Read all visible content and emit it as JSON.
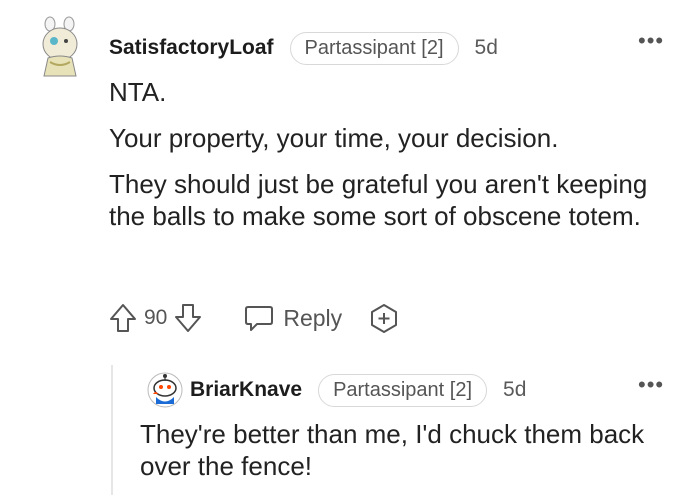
{
  "comment": {
    "author": "SatisfactoryLoaf",
    "flair": "Partassipant [2]",
    "time": "5d",
    "more_label": "•••",
    "paragraphs": [
      "NTA.",
      "Your property, your time, your decision.",
      "They should just be grateful you aren't keeping the balls to make some sort of obscene totem."
    ],
    "votes": "90",
    "reply_label": "Reply"
  },
  "reply": {
    "author": "BriarKnave",
    "flair": "Partassipant [2]",
    "time": "5d",
    "more_label": "•••",
    "text": "They're better than me, I'd chuck them back over the fence!"
  },
  "colors": {
    "text": "#1c1c1c",
    "muted": "#555555",
    "border": "#d8d8d8",
    "thread_line": "#e6e6e6"
  },
  "icons": [
    "upvote-icon",
    "downvote-icon",
    "reply-bubble-icon",
    "award-icon",
    "more-options-icon"
  ]
}
